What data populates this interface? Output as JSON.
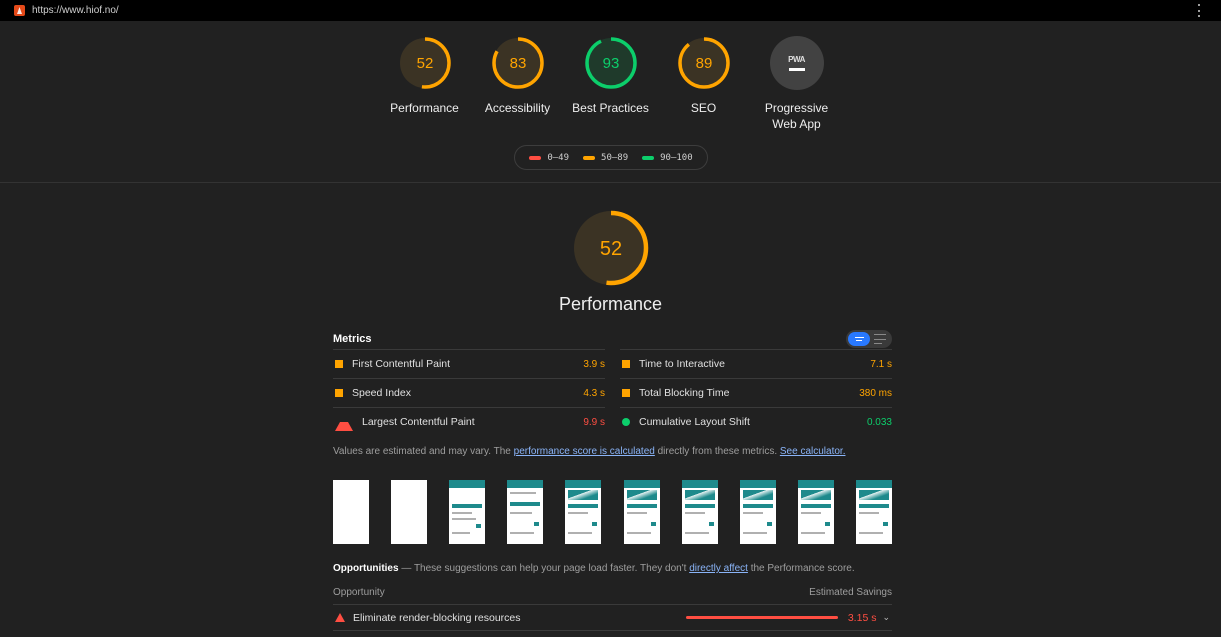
{
  "window": {
    "url": "https://www.hiof.no/"
  },
  "categories": [
    {
      "score": "52",
      "label": "Performance",
      "fraction": 0.52,
      "color": "#ffa400"
    },
    {
      "score": "83",
      "label": "Accessibility",
      "fraction": 0.83,
      "color": "#ffa400"
    },
    {
      "score": "93",
      "label": "Best Practices",
      "fraction": 0.93,
      "color": "#0cce6b"
    },
    {
      "score": "89",
      "label": "SEO",
      "fraction": 0.89,
      "color": "#ffa400"
    },
    {
      "badge": "PWA",
      "label": "Progressive Web App"
    }
  ],
  "legend": [
    {
      "range": "0–49",
      "color": "#ff4e42"
    },
    {
      "range": "50–89",
      "color": "#ffa400"
    },
    {
      "range": "90–100",
      "color": "#0cce6b"
    }
  ],
  "performance": {
    "score": "52",
    "fraction": 0.52,
    "title": "Performance",
    "metrics_title": "Metrics",
    "metrics": [
      {
        "name": "First Contentful Paint",
        "value": "3.9 s",
        "status": "average"
      },
      {
        "name": "Time to Interactive",
        "value": "7.1 s",
        "status": "average"
      },
      {
        "name": "Speed Index",
        "value": "4.3 s",
        "status": "average"
      },
      {
        "name": "Total Blocking Time",
        "value": "380 ms",
        "status": "average"
      },
      {
        "name": "Largest Contentful Paint",
        "value": "9.9 s",
        "status": "fail"
      },
      {
        "name": "Cumulative Layout Shift",
        "value": "0.033",
        "status": "pass"
      }
    ],
    "note": {
      "prefix": "Values are estimated and may vary. The ",
      "link1": "performance score is calculated",
      "middle": " directly from these metrics. ",
      "link2": "See calculator."
    }
  },
  "opportunities": {
    "title": "Opportunities",
    "desc_prefix": " — These suggestions can help your page load faster. They don't ",
    "desc_link": "directly affect",
    "desc_suffix": " the Performance score.",
    "col_opportunity": "Opportunity",
    "col_savings": "Estimated Savings",
    "items": [
      {
        "name": "Eliminate render-blocking resources",
        "savings": "3.15 s"
      }
    ]
  },
  "colors": {
    "pass": "#0cce6b",
    "average": "#ffa400",
    "fail": "#ff4e42"
  }
}
